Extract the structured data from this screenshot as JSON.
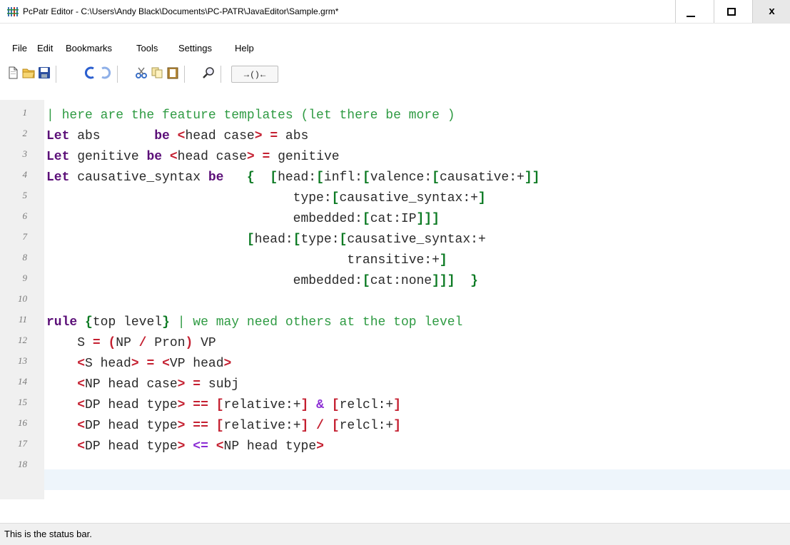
{
  "window": {
    "title": "PcPatr Editor - C:\\Users\\Andy Black\\Documents\\PC-PATR\\JavaEditor\\Sample.grm*"
  },
  "menu": [
    "File",
    "Edit",
    "Bookmarks",
    "Tools",
    "Settings",
    "Help"
  ],
  "toolbar": {
    "bracket_label": "→( )←"
  },
  "status": "This is the status bar.",
  "line_numbers": [
    "1",
    "2",
    "3",
    "4",
    "5",
    "6",
    "7",
    "8",
    "9",
    "10",
    "11",
    "12",
    "13",
    "14",
    "15",
    "16",
    "17",
    "18"
  ],
  "code": {
    "l1_comment": "| here are the feature templates (let there be more )",
    "l2_kw": "Let",
    "l2_name": " abs       ",
    "l2_be": "be",
    "l2_lt": "<",
    "l2_path": "head case",
    "l2_gt": ">",
    "l2_eq": "=",
    "l2_val": " abs",
    "l3_kw": "Let",
    "l3_name": " genitive ",
    "l3_be": "be",
    "l3_lt": "<",
    "l3_path": "head case",
    "l3_gt": ">",
    "l3_eq": "=",
    "l3_val": " genitive",
    "l4_kw": "Let",
    "l4_name": " causative_syntax ",
    "l4_be": "be",
    "l4_ob": "{",
    "l4_a": "head:",
    "l4_b": "infl:",
    "l4_c": "valence:",
    "l4_d": "causative:+",
    "l5_a": "type:",
    "l5_b": "causative_syntax:+",
    "l6_a": "embedded:",
    "l6_b": "cat:IP",
    "l7_a": "head:",
    "l7_b": "type:",
    "l7_c": "causative_syntax:+",
    "l8_a": "transitive:+",
    "l9_a": "embedded:",
    "l9_b": "cat:none",
    "l9_cb": "}",
    "l11_kw": "rule",
    "l11_a": "top level",
    "l11_comment": "| we may need others at the top level",
    "l12_a": "S ",
    "l12_eq": "=",
    "l12_b": "NP ",
    "l12_slash": "/",
    "l12_c": " Pron",
    "l12_d": " VP",
    "l13_a": "S head",
    "l13_eq": "=",
    "l13_b": "VP head",
    "l14_a": "NP head case",
    "l14_eq": "=",
    "l14_b": " subj",
    "l15_a": "DP head type",
    "l15_op": "==",
    "l15_b": "relative:+",
    "l15_amp": "&",
    "l15_c": "relcl:+",
    "l16_a": "DP head type",
    "l16_op": "==",
    "l16_b": "relative:+",
    "l16_slash": "/",
    "l16_c": "relcl:+",
    "l17_a": "DP head type",
    "l17_op": "<=",
    "l17_b": "NP head type"
  }
}
